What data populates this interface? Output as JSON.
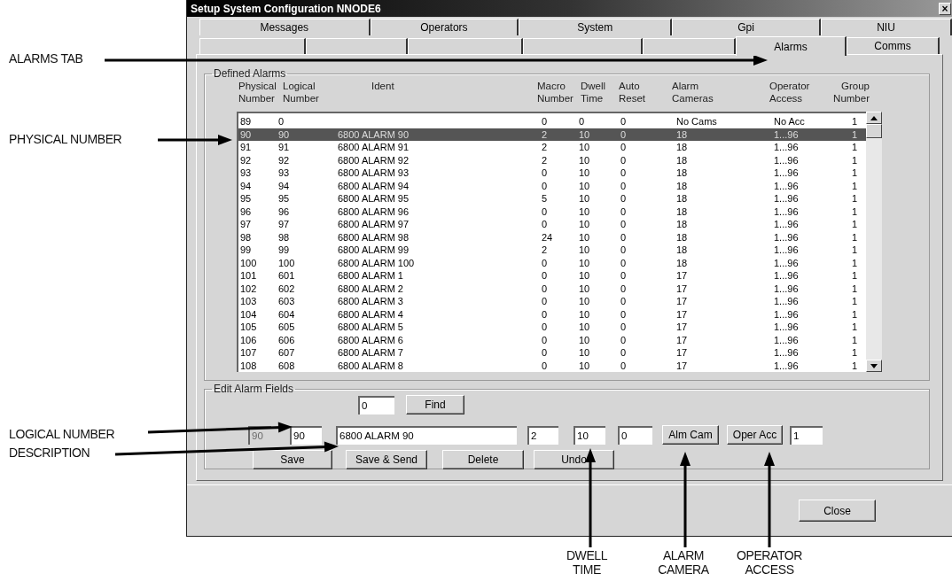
{
  "window": {
    "title": "Setup System Configuration  NNODE6",
    "close_glyph": "×"
  },
  "tabs": {
    "back_row": [
      {
        "label": "Messages"
      },
      {
        "label": "Operators"
      },
      {
        "label": "System"
      },
      {
        "label": "Gpi"
      },
      {
        "label": "NIU"
      }
    ],
    "front_row": [
      {
        "label": "Alarms",
        "selected": true
      },
      {
        "label": "Comms",
        "selected": false
      }
    ]
  },
  "defined_alarms": {
    "legend": "Defined Alarms",
    "columns": [
      {
        "lines": [
          "Physical",
          "Number"
        ]
      },
      {
        "lines": [
          "Logical",
          "Number"
        ]
      },
      {
        "lines": [
          "Ident"
        ]
      },
      {
        "lines": [
          "Macro",
          "Number"
        ]
      },
      {
        "lines": [
          "Dwell",
          "Time"
        ]
      },
      {
        "lines": [
          "Auto",
          "Reset"
        ]
      },
      {
        "lines": [
          "Alarm",
          "Cameras"
        ]
      },
      {
        "lines": [
          "Operator",
          "Access"
        ]
      },
      {
        "lines": [
          "Group",
          "Number"
        ]
      }
    ],
    "rows": [
      {
        "cells": [
          "89",
          "0",
          "",
          "0",
          "0",
          "0",
          "No Cams",
          "No Acc",
          "1"
        ],
        "selected": false
      },
      {
        "cells": [
          "90",
          "90",
          "6800 ALARM 90",
          "2",
          "10",
          "0",
          "18",
          "1...96",
          "1"
        ],
        "selected": true
      },
      {
        "cells": [
          "91",
          "91",
          "6800 ALARM 91",
          "2",
          "10",
          "0",
          "18",
          "1...96",
          "1"
        ],
        "selected": false
      },
      {
        "cells": [
          "92",
          "92",
          "6800 ALARM 92",
          "2",
          "10",
          "0",
          "18",
          "1...96",
          "1"
        ],
        "selected": false
      },
      {
        "cells": [
          "93",
          "93",
          "6800 ALARM 93",
          "0",
          "10",
          "0",
          "18",
          "1...96",
          "1"
        ],
        "selected": false
      },
      {
        "cells": [
          "94",
          "94",
          "6800 ALARM 94",
          "0",
          "10",
          "0",
          "18",
          "1...96",
          "1"
        ],
        "selected": false
      },
      {
        "cells": [
          "95",
          "95",
          "6800 ALARM 95",
          "5",
          "10",
          "0",
          "18",
          "1...96",
          "1"
        ],
        "selected": false
      },
      {
        "cells": [
          "96",
          "96",
          "6800 ALARM 96",
          "0",
          "10",
          "0",
          "18",
          "1...96",
          "1"
        ],
        "selected": false
      },
      {
        "cells": [
          "97",
          "97",
          "6800 ALARM 97",
          "0",
          "10",
          "0",
          "18",
          "1...96",
          "1"
        ],
        "selected": false
      },
      {
        "cells": [
          "98",
          "98",
          "6800 ALARM 98",
          "24",
          "10",
          "0",
          "18",
          "1...96",
          "1"
        ],
        "selected": false
      },
      {
        "cells": [
          "99",
          "99",
          "6800 ALARM 99",
          "2",
          "10",
          "0",
          "18",
          "1...96",
          "1"
        ],
        "selected": false
      },
      {
        "cells": [
          "100",
          "100",
          "6800 ALARM 100",
          "0",
          "10",
          "0",
          "18",
          "1...96",
          "1"
        ],
        "selected": false
      },
      {
        "cells": [
          "101",
          "601",
          "6800 ALARM 1",
          "0",
          "10",
          "0",
          "17",
          "1...96",
          "1"
        ],
        "selected": false
      },
      {
        "cells": [
          "102",
          "602",
          "6800 ALARM 2",
          "0",
          "10",
          "0",
          "17",
          "1...96",
          "1"
        ],
        "selected": false
      },
      {
        "cells": [
          "103",
          "603",
          "6800 ALARM 3",
          "0",
          "10",
          "0",
          "17",
          "1...96",
          "1"
        ],
        "selected": false
      },
      {
        "cells": [
          "104",
          "604",
          "6800 ALARM 4",
          "0",
          "10",
          "0",
          "17",
          "1...96",
          "1"
        ],
        "selected": false
      },
      {
        "cells": [
          "105",
          "605",
          "6800 ALARM 5",
          "0",
          "10",
          "0",
          "17",
          "1...96",
          "1"
        ],
        "selected": false
      },
      {
        "cells": [
          "106",
          "606",
          "6800 ALARM 6",
          "0",
          "10",
          "0",
          "17",
          "1...96",
          "1"
        ],
        "selected": false
      },
      {
        "cells": [
          "107",
          "607",
          "6800 ALARM 7",
          "0",
          "10",
          "0",
          "17",
          "1...96",
          "1"
        ],
        "selected": false
      },
      {
        "cells": [
          "108",
          "608",
          "6800 ALARM 8",
          "0",
          "10",
          "0",
          "17",
          "1...96",
          "1"
        ],
        "selected": false
      }
    ]
  },
  "edit_alarm_fields": {
    "legend": "Edit Alarm Fields",
    "search_value": "0",
    "find_button": "Find",
    "row": [
      {
        "kind": "field",
        "value": "90",
        "disabled": true
      },
      {
        "kind": "field",
        "value": "90",
        "disabled": false
      },
      {
        "kind": "field",
        "value": "6800 ALARM 90",
        "disabled": false
      },
      {
        "kind": "field",
        "value": "2",
        "disabled": false
      },
      {
        "kind": "field",
        "value": "10",
        "disabled": false
      },
      {
        "kind": "field",
        "value": "0",
        "disabled": false
      },
      {
        "kind": "button",
        "label": "Alm Cam"
      },
      {
        "kind": "button",
        "label": "Oper Acc"
      },
      {
        "kind": "field",
        "value": "1",
        "disabled": false
      }
    ],
    "buttons": [
      "Save",
      "Save & Send",
      "Delete",
      "Undo"
    ]
  },
  "close_button": "Close",
  "annotations": [
    {
      "lines": [
        "ALARMS TAB"
      ]
    },
    {
      "lines": [
        "PHYSICAL NUMBER"
      ]
    },
    {
      "lines": [
        "LOGICAL NUMBER"
      ]
    },
    {
      "lines": [
        "DESCRIPTION"
      ]
    },
    {
      "lines": [
        "DWELL",
        "TIME"
      ]
    },
    {
      "lines": [
        "ALARM",
        "CAMERA"
      ]
    },
    {
      "lines": [
        "OPERATOR",
        "ACCESS"
      ]
    }
  ]
}
